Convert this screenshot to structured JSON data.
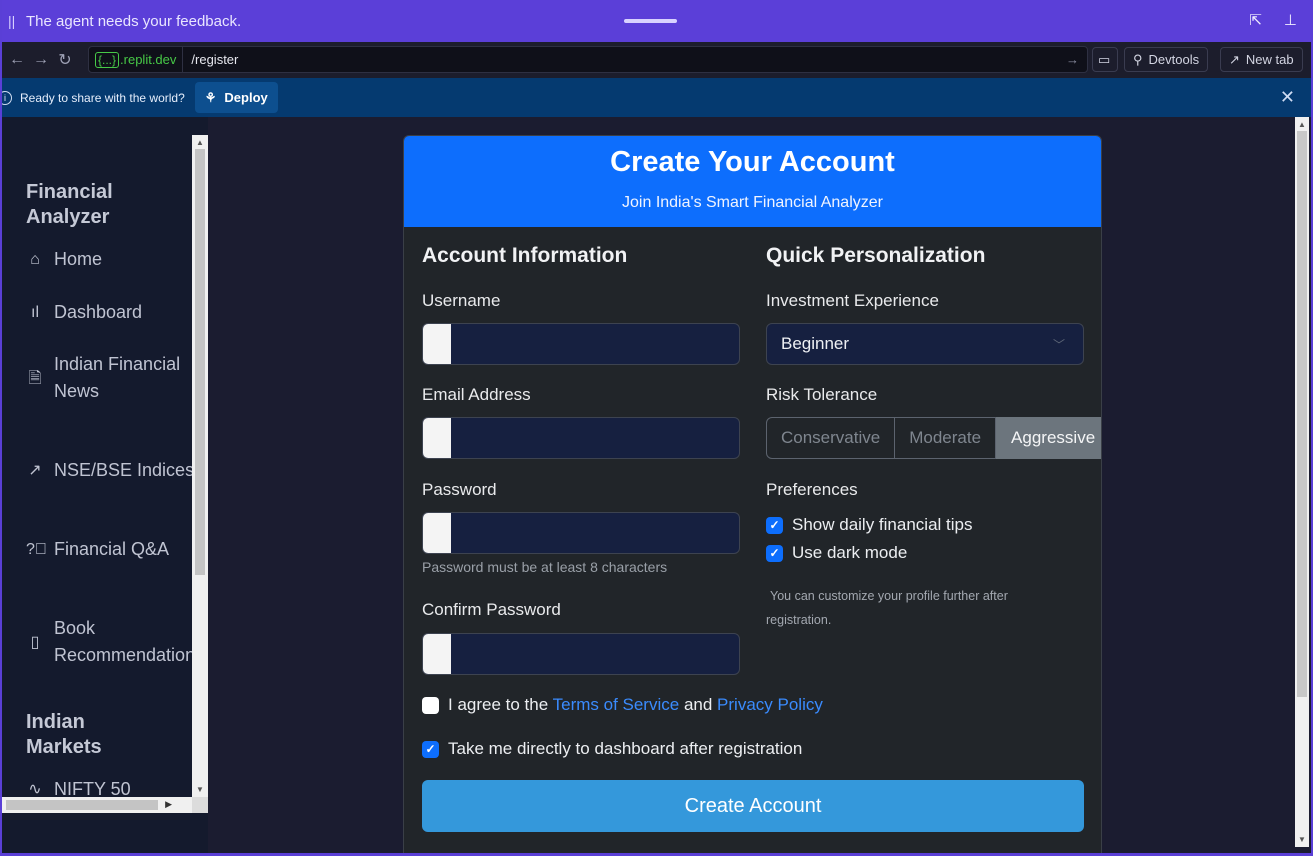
{
  "agent_bar": {
    "message": "The agent needs your feedback."
  },
  "address_bar": {
    "host_bracket": "{...}",
    "host": ".replit.dev",
    "path": "/register",
    "devtools_label": "Devtools",
    "new_tab_label": "New tab"
  },
  "deploy_banner": {
    "message": "Ready to share with the world?",
    "deploy_label": "Deploy"
  },
  "sidebar": {
    "title": "Financial Analyzer",
    "title_line1": "Financial",
    "title_line2": "Analyzer",
    "items": [
      {
        "label": "Home",
        "icon": "home-icon"
      },
      {
        "label": "Dashboard",
        "icon": "bar-chart-icon"
      },
      {
        "label_line1": "Indian Financial",
        "label_line2": "News",
        "icon": "document-icon"
      },
      {
        "label": "NSE/BSE Indices",
        "icon": "trend-up-icon"
      },
      {
        "label": "Financial Q&A",
        "icon": "question-circle-icon"
      },
      {
        "label_line1": "Book",
        "label_line2": "Recommendations",
        "icon": "book-icon"
      }
    ],
    "section2_line1": "Indian",
    "section2_line2": "Markets",
    "section2_items": [
      {
        "label": "NIFTY 50",
        "icon": "pulse-icon"
      }
    ]
  },
  "form": {
    "title": "Create Your Account",
    "subtitle": "Join India's Smart Financial Analyzer",
    "account_heading": "Account Information",
    "username_label": "Username",
    "username_value": "",
    "email_label": "Email Address",
    "email_value": "",
    "password_label": "Password",
    "password_value": "",
    "password_help": "Password must be at least 8 characters",
    "confirm_label": "Confirm Password",
    "confirm_value": "",
    "personal_heading": "Quick Personalization",
    "experience_label": "Investment Experience",
    "experience_value": "Beginner",
    "risk_label": "Risk Tolerance",
    "risk_options": [
      "Conservative",
      "Moderate",
      "Aggressive"
    ],
    "risk_selected": "Aggressive",
    "preferences_label": "Preferences",
    "pref_tips": {
      "label": "Show daily financial tips",
      "checked": true
    },
    "pref_dark": {
      "label": "Use dark mode",
      "checked": true
    },
    "customize_note": "You can customize your profile further after registration.",
    "agree_prefix": "I agree to the",
    "terms_link": "Terms of Service",
    "agree_and": "and",
    "privacy_link": "Privacy Policy",
    "agree_checked": false,
    "dashboard_redirect": {
      "label": "Take me directly to dashboard after registration",
      "checked": true
    },
    "submit_label": "Create Account"
  },
  "colors": {
    "primary": "#0d6efd",
    "submit": "#3498db",
    "agent_bar": "#5b3fd8",
    "deploy_bar": "#053a70"
  }
}
